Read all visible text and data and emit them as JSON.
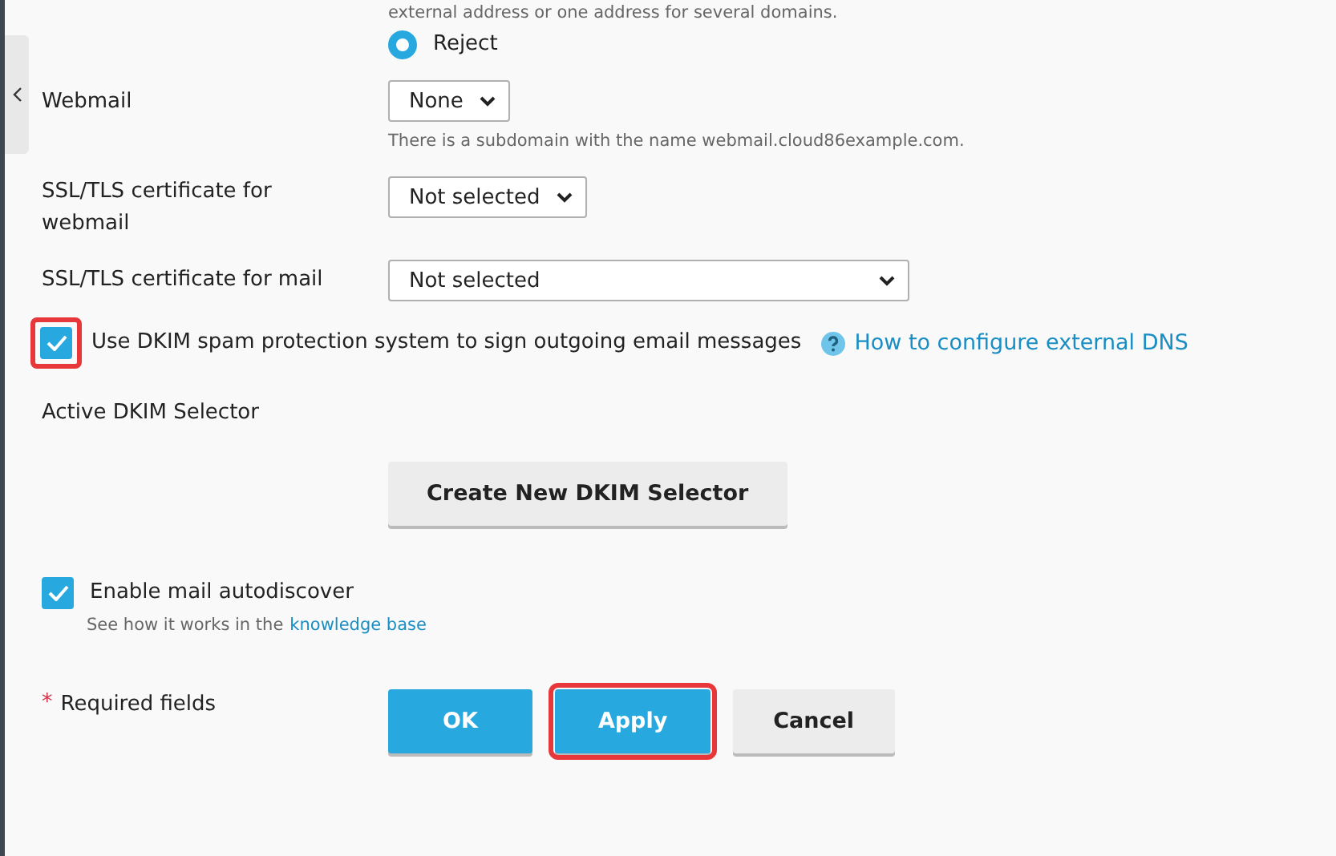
{
  "top_hint": "external address or one address for several domains.",
  "radio": {
    "label": "Reject",
    "selected": true
  },
  "webmail": {
    "label": "Webmail",
    "value": "None",
    "hint": "There is a subdomain with the name webmail.cloud86example.com."
  },
  "ssl_webmail": {
    "label": "SSL/TLS certificate for webmail",
    "value": "Not selected"
  },
  "ssl_mail": {
    "label": "SSL/TLS certificate for mail",
    "value": "Not selected"
  },
  "dkim": {
    "label": "Use DKIM spam protection system to sign outgoing email messages",
    "checked": true,
    "highlighted": true,
    "help_link": "How to configure external DNS"
  },
  "dkim_selector": {
    "label": "Active DKIM Selector",
    "button": "Create New DKIM Selector"
  },
  "autodiscover": {
    "label": "Enable mail autodiscover",
    "checked": true,
    "hint": "See how it works in the",
    "link": "knowledge base"
  },
  "required": {
    "mark": "*",
    "label": "Required fields"
  },
  "buttons": [
    {
      "label": "OK",
      "kind": "primary",
      "highlighted": false
    },
    {
      "label": "Apply",
      "kind": "primary",
      "highlighted": true
    },
    {
      "label": "Cancel",
      "kind": "secondary",
      "highlighted": false
    }
  ]
}
